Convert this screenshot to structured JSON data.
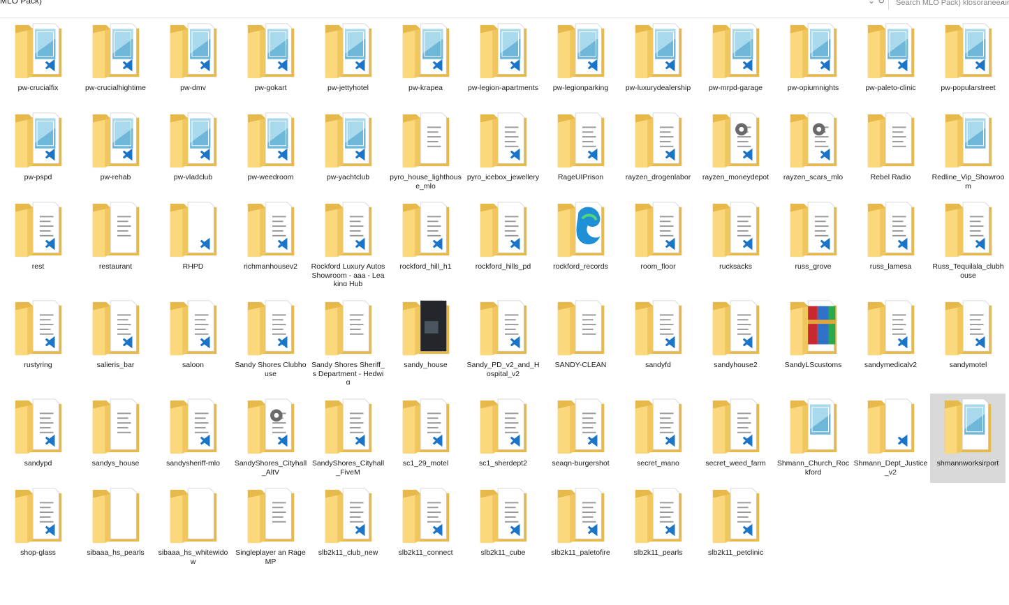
{
  "window": {
    "path_fragment": "MLO Pack)",
    "search_placeholder": "Search MLO Pack) klosoranee ura"
  },
  "colors": {
    "folder_back": "#e6b94a",
    "folder_front": "#fbd87c",
    "selection": "#d9d9d9",
    "vscode_blue": "#1a75c8"
  },
  "folders": [
    {
      "name": "pw-crucialfix",
      "icon": "folder-image-vscode-icon"
    },
    {
      "name": "pw-crucialhightime",
      "icon": "folder-image-vscode-icon"
    },
    {
      "name": "pw-dmv",
      "icon": "folder-image-vscode-icon"
    },
    {
      "name": "pw-gokart",
      "icon": "folder-image-vscode-icon"
    },
    {
      "name": "pw-jettyhotel",
      "icon": "folder-image-vscode-icon"
    },
    {
      "name": "pw-krapea",
      "icon": "folder-image-vscode-icon"
    },
    {
      "name": "pw-legion-apartments",
      "icon": "folder-image-vscode-icon"
    },
    {
      "name": "pw-legionparking",
      "icon": "folder-image-vscode-icon"
    },
    {
      "name": "pw-luxurydealership",
      "icon": "folder-image-vscode-icon"
    },
    {
      "name": "pw-mrpd-garage",
      "icon": "folder-image-vscode-icon"
    },
    {
      "name": "pw-opiumnights",
      "icon": "folder-image-vscode-icon"
    },
    {
      "name": "pw-paleto-clinic",
      "icon": "folder-image-vscode-icon"
    },
    {
      "name": "pw-popularstreet",
      "icon": "folder-image-vscode-icon"
    },
    {
      "name": "pw-pspd",
      "icon": "folder-image-vscode-icon"
    },
    {
      "name": "pw-rehab",
      "icon": "folder-image-vscode-icon"
    },
    {
      "name": "pw-vladclub",
      "icon": "folder-image-vscode-icon"
    },
    {
      "name": "pw-weedroom",
      "icon": "folder-image-vscode-icon"
    },
    {
      "name": "pw-yachtclub",
      "icon": "folder-image-vscode-icon"
    },
    {
      "name": "pyro_house_lighthouse_mlo",
      "icon": "folder-docs-icon"
    },
    {
      "name": "pyro_icebox_jewellery",
      "icon": "folder-docs-vscode-icon"
    },
    {
      "name": "RageUIPrison",
      "icon": "folder-docs-vscode-icon"
    },
    {
      "name": "rayzen_drogenlabor",
      "icon": "folder-docs-vscode-icon"
    },
    {
      "name": "rayzen_moneydepot",
      "icon": "folder-gear-vscode-icon"
    },
    {
      "name": "rayzen_scars_mlo",
      "icon": "folder-gear-vscode-icon"
    },
    {
      "name": "Rebel Radio",
      "icon": "folder-docs-icon"
    },
    {
      "name": "Redline_Vip_Showroom",
      "icon": "folder-image-icon"
    },
    {
      "name": "rest",
      "icon": "folder-docs-vscode-icon"
    },
    {
      "name": "restaurant",
      "icon": "folder-docs-icon"
    },
    {
      "name": "RHPD",
      "icon": "folder-blank-vscode-icon"
    },
    {
      "name": "richmanhousev2",
      "icon": "folder-docs-vscode-icon"
    },
    {
      "name": "Rockford Luxury Autos Showroom - aaa - Leaking Hub",
      "icon": "folder-docs-vscode-icon"
    },
    {
      "name": "rockford_hill_h1",
      "icon": "folder-docs-vscode-icon"
    },
    {
      "name": "rockford_hills_pd",
      "icon": "folder-docs-vscode-icon"
    },
    {
      "name": "rockford_records",
      "icon": "folder-edge-icon"
    },
    {
      "name": "room_floor",
      "icon": "folder-docs-vscode-icon"
    },
    {
      "name": "rucksacks",
      "icon": "folder-docs-vscode-icon"
    },
    {
      "name": "russ_grove",
      "icon": "folder-docs-vscode-icon"
    },
    {
      "name": "russ_lamesa",
      "icon": "folder-docs-vscode-icon"
    },
    {
      "name": "Russ_Tequilala_clubhouse",
      "icon": "folder-docs-vscode-icon"
    },
    {
      "name": "rustyring",
      "icon": "folder-docs-vscode-icon"
    },
    {
      "name": "salieris_bar",
      "icon": "folder-docs-vscode-icon"
    },
    {
      "name": "saloon",
      "icon": "folder-docs-vscode-icon"
    },
    {
      "name": "Sandy Shores Clubhouse",
      "icon": "folder-docs-vscode-icon"
    },
    {
      "name": "Sandy Shores Sheriff_s Department - Hedwig",
      "icon": "folder-docs-icon"
    },
    {
      "name": "sandy_house",
      "icon": "folder-photo-icon"
    },
    {
      "name": "Sandy_PD_v2_and_Hospital_v2",
      "icon": "folder-docs-vscode-icon"
    },
    {
      "name": "SANDY-CLEAN",
      "icon": "folder-docs-icon"
    },
    {
      "name": "sandyfd",
      "icon": "folder-docs-vscode-icon"
    },
    {
      "name": "sandyhouse2",
      "icon": "folder-docs-vscode-icon"
    },
    {
      "name": "SandyLScustoms",
      "icon": "folder-winrar-icon"
    },
    {
      "name": "sandymedicalv2",
      "icon": "folder-docs-vscode-icon"
    },
    {
      "name": "sandymotel",
      "icon": "folder-docs-vscode-icon"
    },
    {
      "name": "sandypd",
      "icon": "folder-docs-vscode-icon"
    },
    {
      "name": "sandys_house",
      "icon": "folder-docs-icon"
    },
    {
      "name": "sandysheriff-mlo",
      "icon": "folder-docs-vscode-icon"
    },
    {
      "name": "SandyShores_Cityhall_AltV",
      "icon": "folder-gear-vscode-icon"
    },
    {
      "name": "SandyShores_Cityhall_FiveM",
      "icon": "folder-docs-vscode-icon"
    },
    {
      "name": "sc1_29_motel",
      "icon": "folder-docs-vscode-icon"
    },
    {
      "name": "sc1_sherdept2",
      "icon": "folder-docs-vscode-icon"
    },
    {
      "name": "seaqn-burgershot",
      "icon": "folder-docs-vscode-icon"
    },
    {
      "name": "secret_mano",
      "icon": "folder-docs-vscode-icon"
    },
    {
      "name": "secret_weed_farm",
      "icon": "folder-docs-vscode-icon"
    },
    {
      "name": "Shmann_Church_Rockford",
      "icon": "folder-image-icon"
    },
    {
      "name": "Shmann_Dept_Justice_v2",
      "icon": "folder-blank-vscode-icon"
    },
    {
      "name": "shmannworksirport",
      "icon": "folder-image-icon",
      "selected": true
    },
    {
      "name": "shop-glass",
      "icon": "folder-docs-vscode-icon"
    },
    {
      "name": "sibaaa_hs_pearls",
      "icon": "folder-blank-icon"
    },
    {
      "name": "sibaaa_hs_whitewidow",
      "icon": "folder-blank-icon"
    },
    {
      "name": "Singleplayer an RageMP",
      "icon": "folder-docs-icon"
    },
    {
      "name": "slb2k11_club_new",
      "icon": "folder-docs-vscode-icon"
    },
    {
      "name": "slb2k11_connect",
      "icon": "folder-docs-vscode-icon"
    },
    {
      "name": "slb2k11_cube",
      "icon": "folder-docs-vscode-icon"
    },
    {
      "name": "slb2k11_paletofire",
      "icon": "folder-docs-vscode-icon"
    },
    {
      "name": "slb2k11_pearls",
      "icon": "folder-docs-vscode-icon"
    },
    {
      "name": "slb2k11_petclinic",
      "icon": "folder-docs-vscode-icon"
    }
  ]
}
